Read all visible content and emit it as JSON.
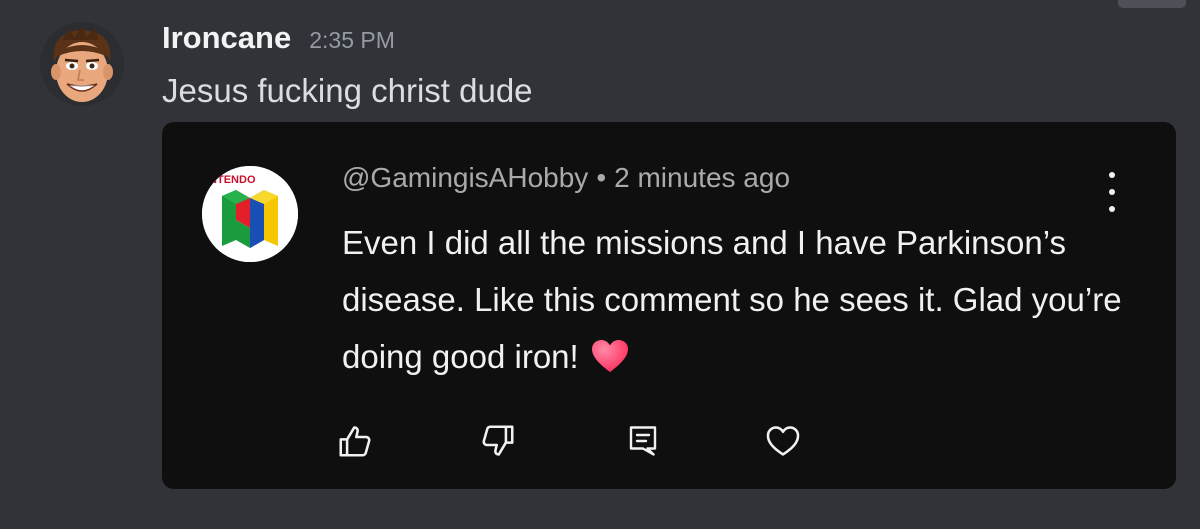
{
  "message": {
    "username": "Ironcane",
    "timestamp": "2:35 PM",
    "text": "Jesus fucking christ dude"
  },
  "embed": {
    "channel_logo_text": "INTENDO",
    "handle": "@GamingisAHobby",
    "separator": "•",
    "time_ago": "2 minutes ago",
    "comment_text": "Even I did all the missions and I have Parkinson’s disease. Like this comment so he sees it. Glad you’re doing good iron!",
    "actions": [
      "like-icon",
      "dislike-icon",
      "reply-icon",
      "heart-icon"
    ],
    "menu_icon": "more-vertical-icon"
  },
  "colors": {
    "background": "#313338",
    "embed_background": "#0f0f0f",
    "username": "#f2f3f5",
    "timestamp": "#949ba4",
    "heart_emoji": "#ff3b6b"
  }
}
